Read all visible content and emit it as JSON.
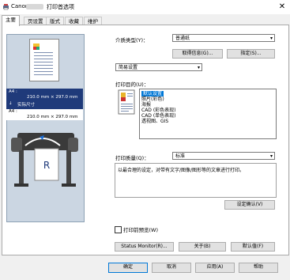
{
  "window": {
    "title_brand": "Canon",
    "title_suffix": "打印首选项",
    "close_glyph": "✕"
  },
  "tabs": [
    {
      "label": "主要"
    },
    {
      "label": "页设置"
    },
    {
      "label": "版式"
    },
    {
      "label": "收藏"
    },
    {
      "label": "维护"
    }
  ],
  "preview": {
    "paper_size_1": "A4 :",
    "dimensions_1": "210.0 mm × 297.0 mm",
    "actual_size": "实际尺寸",
    "paper_size_2": "A4 :",
    "dimensions_2": "210.0 mm × 297.0 mm"
  },
  "media": {
    "label": "介质类型(Y)：",
    "value": "普通纸",
    "get_info_button": "取得信息(G)...",
    "settings_button": "指定(S)..."
  },
  "mode": {
    "value": "简易设置"
  },
  "purpose": {
    "label": "打印目的(U)：",
    "items": [
      "默认设置",
      "照片(彩色)",
      "海报",
      "CAD (彩色表现)",
      "CAD (单色表现)",
      "透视图、GIS"
    ],
    "selected_index": 0
  },
  "quality": {
    "label": "打印质量(Q)：",
    "value": "标准"
  },
  "description": {
    "text": "以最合理的设定，对带有文字/图像/图形等的文章进行打印。"
  },
  "settings_confirm_button": "设定确认(V)",
  "print_preview": {
    "label": "打印前预览(W)",
    "checked": false
  },
  "lower_buttons": {
    "status_monitor": "Status Monitor(R)...",
    "about": "关于(B)",
    "defaults": "默认值(F)"
  },
  "dialog_buttons": {
    "ok": "确定",
    "cancel": "取消",
    "apply": "应用(A)",
    "help": "帮助"
  },
  "colors": {
    "selection": "#0078d7",
    "preview_bg": "#cbd6e2",
    "size_banner": "#1f3a7a"
  }
}
